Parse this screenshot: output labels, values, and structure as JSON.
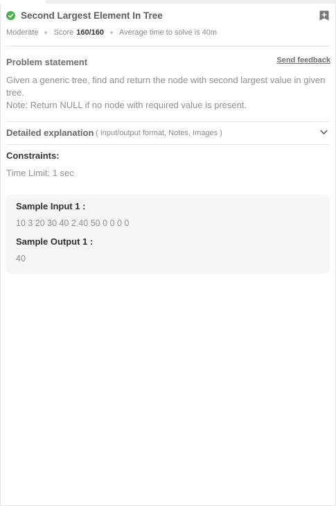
{
  "problem": {
    "title": "Second Largest Element In Tree",
    "difficulty": "Moderate",
    "score_label": "Score",
    "score_value": "160/160",
    "avg_time": "Average time to solve is 40m"
  },
  "statement": {
    "label": "Problem statement",
    "feedback_link": "Send feedback",
    "line1": "Given a generic tree, find and return the node with second largest value in given tree.",
    "note": "Note: Return NULL if no node with required value is present."
  },
  "explanation": {
    "label": "Detailed explanation",
    "sublabel": "( Input/output format, Notes, Images )"
  },
  "constraints": {
    "label": "Constraints:",
    "time_limit": "Time Limit: 1 sec"
  },
  "samples": {
    "input_label": "Sample Input 1 :",
    "input_value": "10 3 20 30 40 2 40 50 0 0 0 0",
    "output_label": "Sample Output 1 :",
    "output_value": "40"
  },
  "icons": {
    "solved": "check-circle-icon",
    "bookmark": "bookmark-add-icon",
    "expand": "chevron-down-icon"
  },
  "colors": {
    "solved_green": "#4caf50",
    "sample_bg": "#f6f6f6"
  }
}
